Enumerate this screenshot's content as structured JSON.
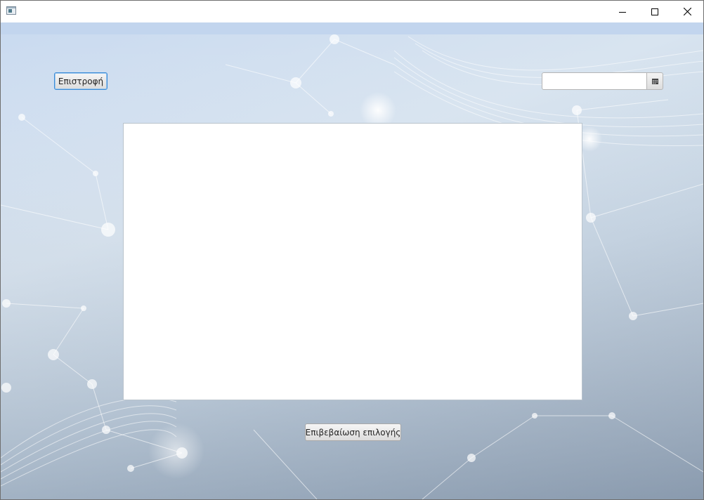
{
  "window": {
    "title": "",
    "icons": {
      "app": "app-window-icon",
      "minimize": "minimize-icon",
      "maximize": "maximize-icon",
      "close": "close-icon"
    }
  },
  "toolbar": {
    "back_label": "Επιστροφή"
  },
  "date_picker": {
    "value": "",
    "placeholder": "",
    "icon": "calendar-icon"
  },
  "list": {
    "items": []
  },
  "footer": {
    "confirm_label": "Επιβεβαίωση επιλογής"
  },
  "colors": {
    "background_top": "#c9daf0",
    "background_bottom": "#9aaabd",
    "focus_border": "#3a8bd6",
    "panel": "#ffffff"
  }
}
